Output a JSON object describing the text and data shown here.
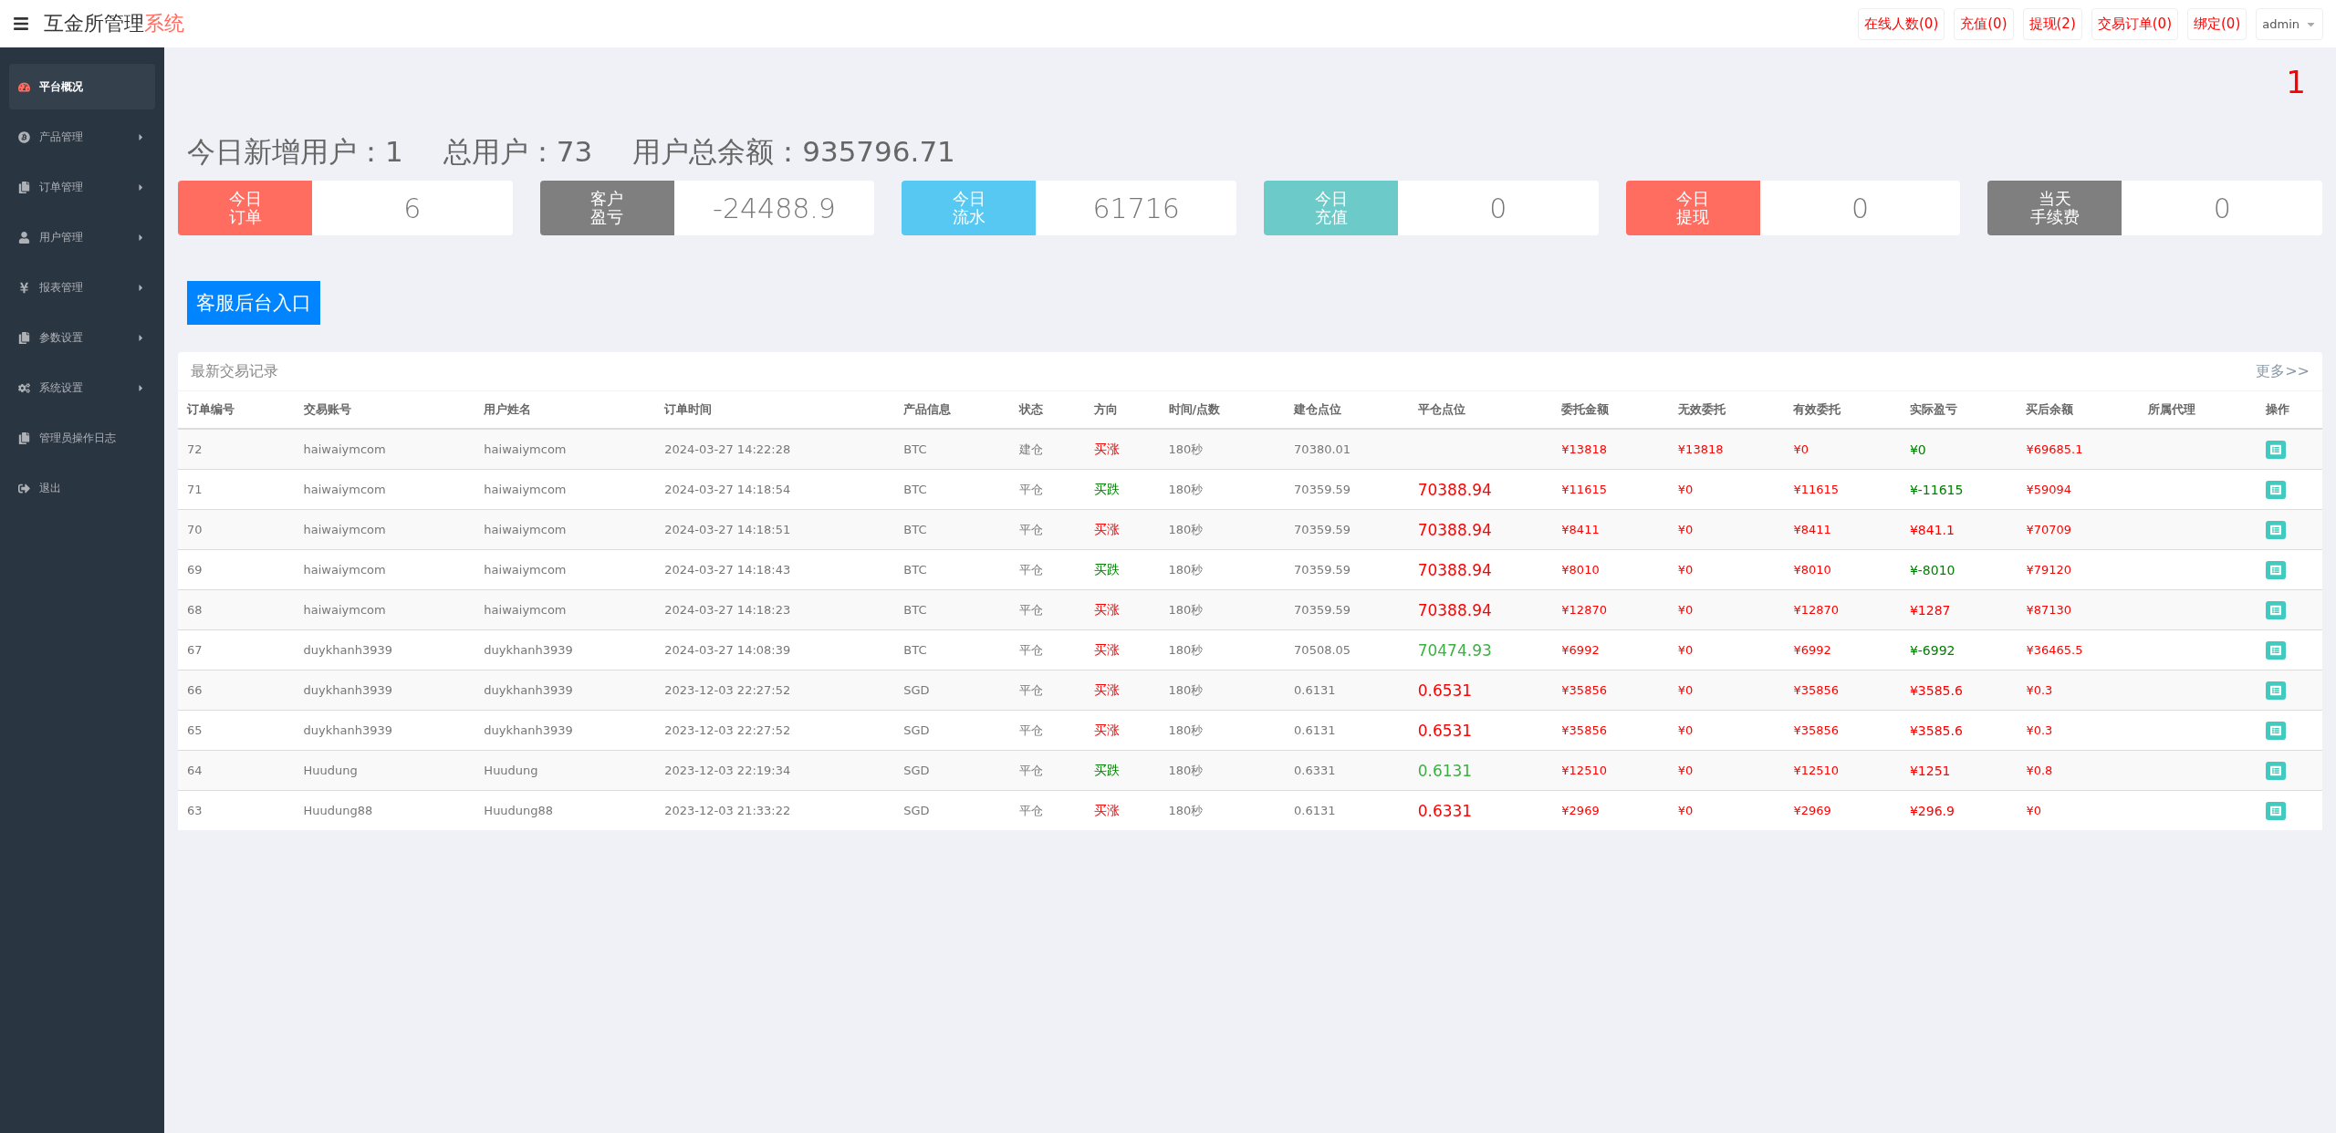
{
  "header": {
    "title": "互金所管理",
    "title_accent": "系统",
    "buttons": [
      "在线人数(0)",
      "充值(0)",
      "提现(2)",
      "交易订单(0)",
      "绑定(0)"
    ],
    "user": "admin"
  },
  "sidebar": {
    "items": [
      {
        "label": "平台概况",
        "selected": true,
        "submenu": false
      },
      {
        "label": "产品管理",
        "selected": false,
        "submenu": true
      },
      {
        "label": "订单管理",
        "selected": false,
        "submenu": true
      },
      {
        "label": "用户管理",
        "selected": false,
        "submenu": true
      },
      {
        "label": "报表管理",
        "selected": false,
        "submenu": true
      },
      {
        "label": "参数设置",
        "selected": false,
        "submenu": true
      },
      {
        "label": "系统设置",
        "selected": false,
        "submenu": true
      },
      {
        "label": "管理员操作日志",
        "selected": false,
        "submenu": false
      },
      {
        "label": "退出",
        "selected": false,
        "submenu": false
      }
    ]
  },
  "corner_number": "1",
  "summary": [
    "今日新增用户：1",
    "总用户：73",
    "用户总余额：935796.71"
  ],
  "cards": [
    {
      "label": [
        "今日",
        "订单"
      ],
      "value": "6",
      "color": "#ff6c60"
    },
    {
      "label": [
        "客户",
        "盈亏"
      ],
      "value": "-24488.9",
      "color": "#7f7f7f"
    },
    {
      "label": [
        "今日",
        "流水"
      ],
      "value": "61716",
      "color": "#57c8f2"
    },
    {
      "label": [
        "今日",
        "充值"
      ],
      "value": "0",
      "color": "#6ccac9"
    },
    {
      "label": [
        "今日",
        "提现"
      ],
      "value": "0",
      "color": "#ff6c60"
    },
    {
      "label": [
        "当天",
        "手续费"
      ],
      "value": "0",
      "color": "#7f7f7f"
    }
  ],
  "service_button": "客服后台入口",
  "records": {
    "title": "最新交易记录",
    "more": "更多>>",
    "columns": [
      "订单编号",
      "交易账号",
      "用户姓名",
      "订单时间",
      "产品信息",
      "状态",
      "方向",
      "时间/点数",
      "建仓点位",
      "平仓点位",
      "委托金额",
      "无效委托",
      "有效委托",
      "实际盈亏",
      "买后余额",
      "所属代理",
      "操作"
    ],
    "rows": [
      {
        "id": "72",
        "account": "haiwaiymcom",
        "name": "haiwaiymcom",
        "time": "2024-03-27 14:22:28",
        "product": "BTC",
        "status": "建仓",
        "direction": {
          "text": "买涨",
          "color": "#ff0000"
        },
        "duration": "180秒",
        "open": "70380.01",
        "amount": "¥13818",
        "invalid": "¥13818",
        "valid": "¥0",
        "pnl": {
          "text": "¥0",
          "color": "#008000"
        },
        "balance": "¥69685.1"
      },
      {
        "id": "71",
        "account": "haiwaiymcom",
        "name": "haiwaiymcom",
        "time": "2024-03-27 14:18:54",
        "product": "BTC",
        "status": "平仓",
        "direction": {
          "text": "买跌",
          "color": "#008000"
        },
        "duration": "180秒",
        "open": "70359.59",
        "close": {
          "text": "70388.94",
          "color": "#ff0000"
        },
        "amount": "¥11615",
        "invalid": "¥0",
        "valid": "¥11615",
        "pnl": {
          "text": "¥-11615",
          "color": "#008000"
        },
        "balance": "¥59094"
      },
      {
        "id": "70",
        "account": "haiwaiymcom",
        "name": "haiwaiymcom",
        "time": "2024-03-27 14:18:51",
        "product": "BTC",
        "status": "平仓",
        "direction": {
          "text": "买涨",
          "color": "#ff0000"
        },
        "duration": "180秒",
        "open": "70359.59",
        "close": {
          "text": "70388.94",
          "color": "#ff0000"
        },
        "amount": "¥8411",
        "invalid": "¥0",
        "valid": "¥8411",
        "pnl": {
          "text": "¥841.1",
          "color": "#ff0000"
        },
        "balance": "¥70709"
      },
      {
        "id": "69",
        "account": "haiwaiymcom",
        "name": "haiwaiymcom",
        "time": "2024-03-27 14:18:43",
        "product": "BTC",
        "status": "平仓",
        "direction": {
          "text": "买跌",
          "color": "#008000"
        },
        "duration": "180秒",
        "open": "70359.59",
        "close": {
          "text": "70388.94",
          "color": "#ff0000"
        },
        "amount": "¥8010",
        "invalid": "¥0",
        "valid": "¥8010",
        "pnl": {
          "text": "¥-8010",
          "color": "#008000"
        },
        "balance": "¥79120"
      },
      {
        "id": "68",
        "account": "haiwaiymcom",
        "name": "haiwaiymcom",
        "time": "2024-03-27 14:18:23",
        "product": "BTC",
        "status": "平仓",
        "direction": {
          "text": "买涨",
          "color": "#ff0000"
        },
        "duration": "180秒",
        "open": "70359.59",
        "close": {
          "text": "70388.94",
          "color": "#ff0000"
        },
        "amount": "¥12870",
        "invalid": "¥0",
        "valid": "¥12870",
        "pnl": {
          "text": "¥1287",
          "color": "#ff0000"
        },
        "balance": "¥87130"
      },
      {
        "id": "67",
        "account": "duykhanh3939",
        "name": "duykhanh3939",
        "time": "2024-03-27 14:08:39",
        "product": "BTC",
        "status": "平仓",
        "direction": {
          "text": "买涨",
          "color": "#ff0000"
        },
        "duration": "180秒",
        "open": "70508.05",
        "close": {
          "text": "70474.93",
          "color": "#3cb043"
        },
        "amount": "¥6992",
        "invalid": "¥0",
        "valid": "¥6992",
        "pnl": {
          "text": "¥-6992",
          "color": "#008000"
        },
        "balance": "¥36465.5"
      },
      {
        "id": "66",
        "account": "duykhanh3939",
        "name": "duykhanh3939",
        "time": "2023-12-03 22:27:52",
        "product": "SGD",
        "status": "平仓",
        "direction": {
          "text": "买涨",
          "color": "#ff0000"
        },
        "duration": "180秒",
        "open": "0.6131",
        "close": {
          "text": "0.6531",
          "color": "#ff0000"
        },
        "amount": "¥35856",
        "invalid": "¥0",
        "valid": "¥35856",
        "pnl": {
          "text": "¥3585.6",
          "color": "#ff0000"
        },
        "balance": "¥0.3"
      },
      {
        "id": "65",
        "account": "duykhanh3939",
        "name": "duykhanh3939",
        "time": "2023-12-03 22:27:52",
        "product": "SGD",
        "status": "平仓",
        "direction": {
          "text": "买涨",
          "color": "#ff0000"
        },
        "duration": "180秒",
        "open": "0.6131",
        "close": {
          "text": "0.6531",
          "color": "#ff0000"
        },
        "amount": "¥35856",
        "invalid": "¥0",
        "valid": "¥35856",
        "pnl": {
          "text": "¥3585.6",
          "color": "#ff0000"
        },
        "balance": "¥0.3"
      },
      {
        "id": "64",
        "account": "Huudung",
        "name": "Huudung",
        "time": "2023-12-03 22:19:34",
        "product": "SGD",
        "status": "平仓",
        "direction": {
          "text": "买跌",
          "color": "#008000"
        },
        "duration": "180秒",
        "open": "0.6331",
        "close": {
          "text": "0.6131",
          "color": "#3cb043"
        },
        "amount": "¥12510",
        "invalid": "¥0",
        "valid": "¥12510",
        "pnl": {
          "text": "¥1251",
          "color": "#ff0000"
        },
        "balance": "¥0.8"
      },
      {
        "id": "63",
        "account": "Huudung88",
        "name": "Huudung88",
        "time": "2023-12-03 21:33:22",
        "product": "SGD",
        "status": "平仓",
        "direction": {
          "text": "买涨",
          "color": "#ff0000"
        },
        "duration": "180秒",
        "open": "0.6131",
        "close": {
          "text": "0.6331",
          "color": "#ff0000"
        },
        "amount": "¥2969",
        "invalid": "¥0",
        "valid": "¥2969",
        "pnl": {
          "text": "¥296.9",
          "color": "#ff0000"
        },
        "balance": "¥0"
      }
    ]
  }
}
